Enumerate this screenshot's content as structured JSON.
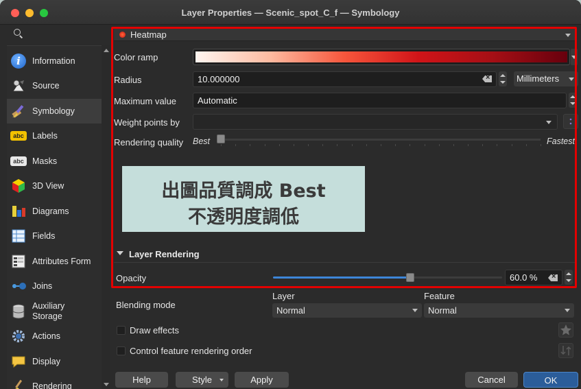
{
  "window": {
    "title": "Layer Properties — Scenic_spot_C_f — Symbology"
  },
  "sidebar": {
    "items": [
      {
        "label": "Information",
        "icon": "info-icon"
      },
      {
        "label": "Source",
        "icon": "source-icon"
      },
      {
        "label": "Symbology",
        "icon": "paintbrush-icon",
        "active": true
      },
      {
        "label": "Labels",
        "icon": "labels-abc-icon"
      },
      {
        "label": "Masks",
        "icon": "masks-abc-icon"
      },
      {
        "label": "3D View",
        "icon": "cube-icon"
      },
      {
        "label": "Diagrams",
        "icon": "diagram-icon"
      },
      {
        "label": "Fields",
        "icon": "fields-icon"
      },
      {
        "label": "Attributes Form",
        "icon": "form-icon"
      },
      {
        "label": "Joins",
        "icon": "joins-icon"
      },
      {
        "label": "Auxiliary\nStorage",
        "label_line1": "Auxiliary",
        "label_line2": "Storage",
        "icon": "database-icon"
      },
      {
        "label": "Actions",
        "icon": "gear-icon"
      },
      {
        "label": "Display",
        "icon": "speech-bubble-icon"
      },
      {
        "label": "Rendering",
        "icon": "brush-icon"
      }
    ]
  },
  "heatmap": {
    "renderer": "Heatmap",
    "color_ramp_label": "Color ramp",
    "radius_label": "Radius",
    "radius_value": "10.000000",
    "radius_unit": "Millimeters",
    "max_value_label": "Maximum value",
    "max_value": "Automatic",
    "weight_label": "Weight points by",
    "weight_value": "",
    "quality_label": "Rendering quality",
    "quality_best": "Best",
    "quality_fastest": "Fastest",
    "quality_level": 0
  },
  "annotation": {
    "line1": "出圖品質調成 Best",
    "line2": "不透明度調低"
  },
  "layer_rendering": {
    "section_label": "Layer Rendering",
    "opacity_label": "Opacity",
    "opacity_value": "60.0 %",
    "opacity_fraction": 0.6,
    "blending_label": "Blending mode",
    "layer_head": "Layer",
    "feature_head": "Feature",
    "layer_blend": "Normal",
    "feature_blend": "Normal",
    "draw_effects_label": "Draw effects",
    "control_order_label": "Control feature rendering order"
  },
  "buttons": {
    "help": "Help",
    "style": "Style",
    "apply": "Apply",
    "cancel": "Cancel",
    "ok": "OK"
  },
  "colors": {
    "accent": "#e30000",
    "ok_button": "#2b5d9a",
    "slider_fill": "#3d86d8"
  }
}
